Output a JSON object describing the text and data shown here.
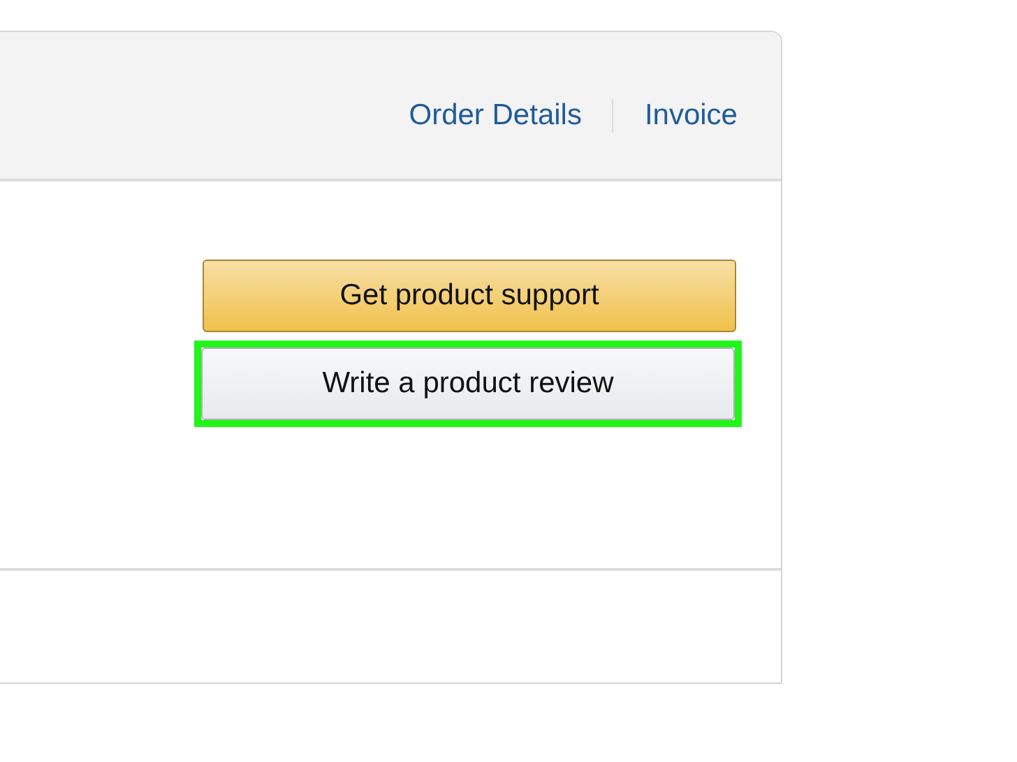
{
  "header": {
    "links": [
      {
        "label": "Order Details"
      },
      {
        "label": "Invoice"
      }
    ]
  },
  "buttons": [
    {
      "label": "Get product support",
      "kind": "primary",
      "highlighted": false
    },
    {
      "label": "Write a product review",
      "kind": "secondary",
      "highlighted": true
    }
  ]
}
